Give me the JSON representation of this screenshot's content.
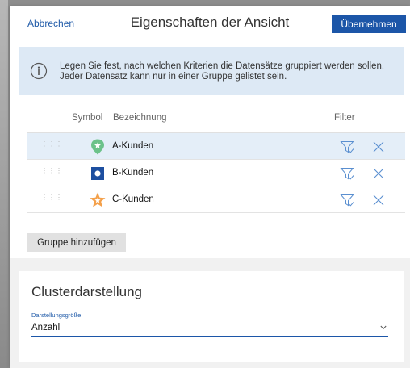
{
  "header": {
    "cancel_label": "Abbrechen",
    "title": "Eigenschaften der Ansicht",
    "apply_label": "Übernehmen"
  },
  "info": {
    "line1": "Legen Sie fest, nach welchen Kriterien die Datensätze gruppiert werden sollen.",
    "line2": "Jeder Datensatz kann nur in einer Gruppe gelistet sein."
  },
  "table": {
    "col_symbol": "Symbol",
    "col_name": "Bezeichnung",
    "col_filter": "Filter",
    "rows": [
      {
        "label": "A-Kunden",
        "icon": "green-star-pin-icon",
        "color": "#6cc28a",
        "selected": true
      },
      {
        "label": "B-Kunden",
        "icon": "blue-square-dot-icon",
        "color": "#1d4fa0",
        "selected": false
      },
      {
        "label": "C-Kunden",
        "icon": "orange-star-icon",
        "color": "#f4a04a",
        "selected": false
      }
    ]
  },
  "add_group_label": "Gruppe hinzufügen",
  "cluster": {
    "heading": "Clusterdarstellung",
    "field_label": "Darstellungsgröße",
    "field_value": "Anzahl"
  },
  "colors": {
    "accent": "#1c56a8",
    "info_bg": "#dde9f5",
    "selected_row": "#e4eef8"
  }
}
